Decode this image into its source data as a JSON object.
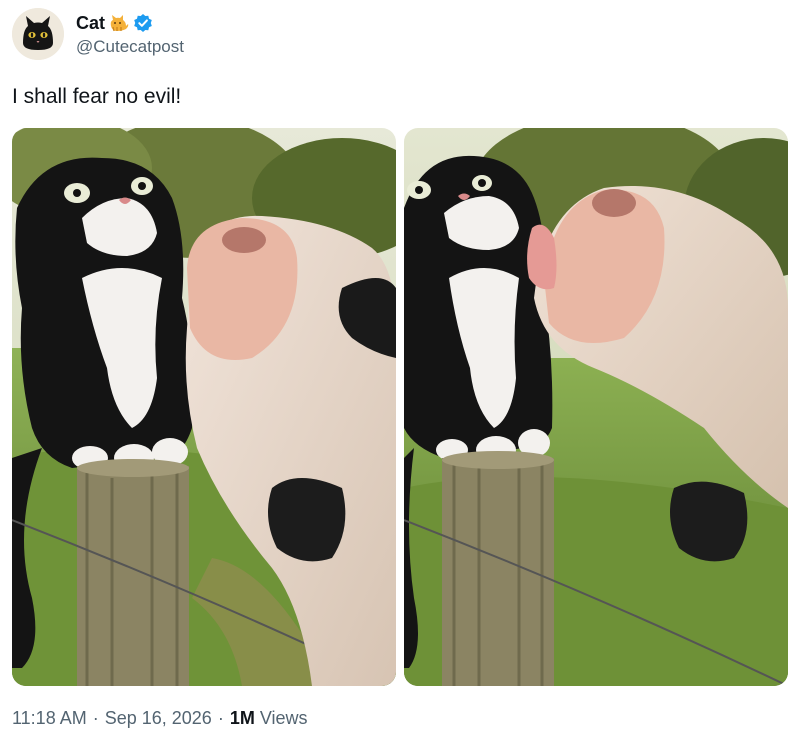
{
  "post": {
    "author": {
      "display_name": "Cat",
      "name_emoji": "cat-emoji",
      "verified_icon": "verified-badge-icon",
      "handle": "@Cutecatpost",
      "avatar": "black-cat-avatar"
    },
    "text": "I shall fear no evil!",
    "media": [
      {
        "description_icon": "photo-cat-and-cow-1"
      },
      {
        "description_icon": "photo-cat-and-cow-2"
      }
    ],
    "meta": {
      "time": "11:18 AM",
      "date": "Sep 16, 2026",
      "separator": "·",
      "views_count": "1M",
      "views_label": "Views"
    }
  },
  "colors": {
    "text_primary": "#0f1419",
    "text_secondary": "#536471",
    "verified_blue": "#1d9bf0"
  }
}
